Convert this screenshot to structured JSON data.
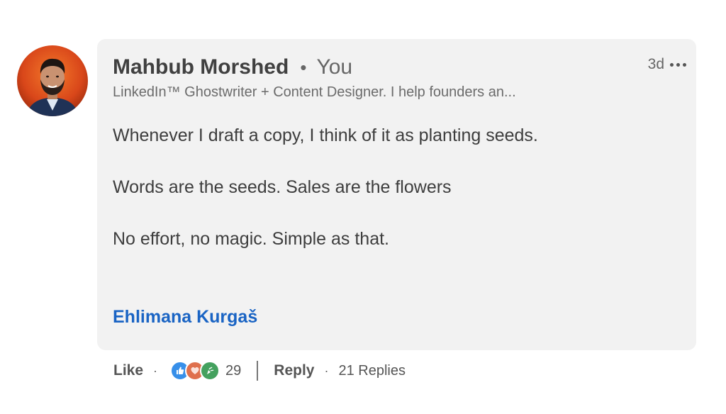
{
  "comment": {
    "author": "Mahbub Morshed",
    "separator": "•",
    "you_label": "You",
    "timestamp": "3d",
    "headline": "LinkedIn™ Ghostwriter + Content Designer. I help founders an...",
    "paragraphs": [
      "Whenever I draft a copy, I think of it as planting seeds.",
      "Words are the seeds. Sales are the flowers",
      "No effort, no magic. Simple as that."
    ],
    "mention": "Ehlimana Kurgaš",
    "more_menu_icon": "more-horizontal-icon",
    "avatar_icon": "profile-photo"
  },
  "actions": {
    "like_label": "Like",
    "dot": "·",
    "reactions": [
      {
        "name": "like-reaction-icon",
        "color": "#378fe9"
      },
      {
        "name": "love-reaction-icon",
        "color": "#df704d"
      },
      {
        "name": "celebrate-reaction-icon",
        "color": "#44a15e"
      }
    ],
    "reaction_count": "29",
    "reply_label": "Reply",
    "replies_label": "21 Replies"
  },
  "colors": {
    "bubble": "#f2f2f2",
    "mention": "#1a64c4"
  }
}
